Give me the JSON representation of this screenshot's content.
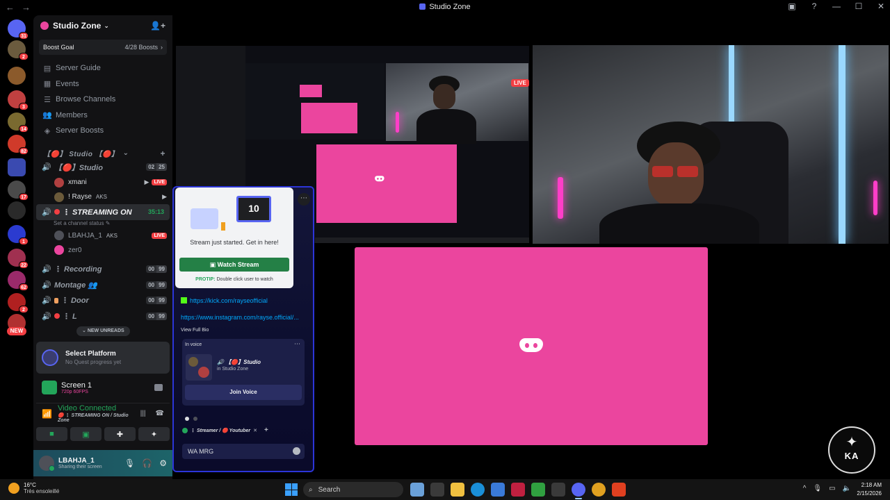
{
  "window": {
    "title": "Studio Zone",
    "back_icon": "←",
    "forward_icon": "→"
  },
  "rail": {
    "servers": [
      {
        "name": "discord-home",
        "color": "#5865f2",
        "badge": "31"
      },
      {
        "name": "server-1",
        "color": "#6b5b3e",
        "badge": "2"
      },
      {
        "name": "server-2",
        "color": "#8b5a2b",
        "badge": ""
      },
      {
        "name": "server-3",
        "color": "#c04040",
        "badge": "3"
      },
      {
        "name": "server-4",
        "color": "#7a6a30",
        "badge": "14"
      },
      {
        "name": "server-5",
        "color": "#d03a2a",
        "badge": "82"
      },
      {
        "name": "folder",
        "color": "#3a4ab0",
        "badge": ""
      },
      {
        "name": "server-6",
        "color": "#4a4a4a",
        "badge": "17"
      },
      {
        "name": "studio-zone",
        "color": "#2a2a2a",
        "badge": ""
      },
      {
        "name": "server-7",
        "color": "#2b3bd0",
        "badge": "1"
      },
      {
        "name": "server-8",
        "color": "#a03050",
        "badge": "22"
      },
      {
        "name": "server-9",
        "color": "#9a2a6a",
        "badge": "62"
      },
      {
        "name": "server-10",
        "color": "#b02020",
        "badge": "2"
      },
      {
        "name": "server-11",
        "color": "#b03030",
        "badge": ""
      }
    ],
    "new_label": "NEW"
  },
  "sidebar": {
    "server_name": "Studio Zone",
    "boost_goal": "Boost Goal",
    "boost_count": "4/28 Boosts",
    "menu": [
      {
        "label": "Server Guide",
        "icon": "▤"
      },
      {
        "label": "Events",
        "icon": "▦"
      },
      {
        "label": "Browse Channels",
        "icon": "☰"
      },
      {
        "label": "Members",
        "icon": "👥"
      },
      {
        "label": "Server Boosts",
        "icon": "◈"
      }
    ],
    "category": "【🔴】 Studio 【🔴】",
    "channels": {
      "studio": {
        "name": "【🔴】Studio",
        "count_a": "02",
        "count_b": "25"
      },
      "streaming": {
        "name": "⋮ STREAMING ON",
        "time": "35:13",
        "status": "Set a channel status ✎"
      },
      "recording": {
        "name": "⋮ Recording",
        "count_a": "00",
        "count_b": "99"
      },
      "montage": {
        "name": "Montage 👥",
        "count_a": "00",
        "count_b": "99"
      },
      "door": {
        "name": "⋮ Door",
        "count_a": "00",
        "count_b": "99"
      },
      "last": {
        "name": "⋮ L",
        "count_a": "00",
        "count_b": "99"
      }
    },
    "studio_users": [
      {
        "name": "xmani",
        "live": "LIVE"
      },
      {
        "name": "! Rayse",
        "tag": "AKS"
      }
    ],
    "streaming_users": [
      {
        "name": "LBAHJA_1",
        "tag": "AKS",
        "live": "LIVE"
      },
      {
        "name": "zer0"
      }
    ],
    "new_unreads": "NEW UNREADS",
    "quest": {
      "title": "Select Platform",
      "subtitle": "No Quest progress yet"
    },
    "screen": {
      "title": "Screen 1",
      "sub": "720p 60FPS"
    },
    "voice": {
      "status": "Video Connected",
      "channel": "🔴 ⋮ STREAMING ON / Studio Zone"
    },
    "user": {
      "name": "LBAHJA_1",
      "status": "Sharing their screen"
    }
  },
  "stage": {
    "live_label": "LIVE",
    "profile": {
      "stream_msg": "Stream just started. Get in here!",
      "watch_btn": "Watch Stream",
      "protip_label": "PROTIP:",
      "protip_text": "Double click user to watch",
      "link_kick": "https://kick.com/rayseofficial",
      "link_insta": "https://www.instagram.com/rayse.official/...",
      "view_bio": "View Full Bio",
      "in_voice": "In voice",
      "voice_channel": "【🔴】Studio",
      "voice_server": "in Studio Zone",
      "join_voice": "Join Voice",
      "roles": "⋮ Streamer / 🔴 Youtuber",
      "message_value": "WA  MRG"
    },
    "watermark_text": "KA"
  },
  "taskbar": {
    "temp": "16°C",
    "weather": "Très ensoleillé",
    "search": "Search",
    "time": "2:18 AM",
    "date": "2/15/2026",
    "apps": [
      {
        "name": "boat-app",
        "color": "#6aa0d8"
      },
      {
        "name": "taskview",
        "color": "#3a3a3a"
      },
      {
        "name": "file-explorer",
        "color": "#f0c040"
      },
      {
        "name": "edge",
        "color": "#1a8fd8"
      },
      {
        "name": "store",
        "color": "#3a7ad8"
      },
      {
        "name": "voicemod",
        "color": "#c02040"
      },
      {
        "name": "game",
        "color": "#30a040"
      },
      {
        "name": "streamlabs",
        "color": "#3a3a3a"
      },
      {
        "name": "discord",
        "color": "#5865f2"
      },
      {
        "name": "chrome",
        "color": "#e0a020"
      },
      {
        "name": "brave",
        "color": "#e04020"
      }
    ]
  }
}
